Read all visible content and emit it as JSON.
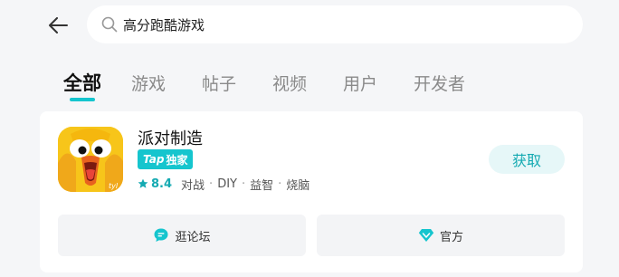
{
  "search": {
    "query": "高分跑酷游戏"
  },
  "tabs": [
    {
      "label": "全部",
      "active": true
    },
    {
      "label": "游戏",
      "active": false
    },
    {
      "label": "帖子",
      "active": false
    },
    {
      "label": "视频",
      "active": false
    },
    {
      "label": "用户",
      "active": false
    },
    {
      "label": "开发者",
      "active": false
    }
  ],
  "result": {
    "app_name": "派对制造",
    "badge_brand": "Tap",
    "badge_text": "独家",
    "rating": "8.4",
    "tags": [
      "对战",
      "DIY",
      "益智",
      "烧脑"
    ],
    "get_label": "获取",
    "forum_label": "逛论坛",
    "official_label": "官方",
    "icon_text": "tyl"
  },
  "colors": {
    "accent": "#15c5ce",
    "background": "#f5f6f8",
    "card": "#ffffff"
  },
  "icons": {
    "back": "arrow-left-icon",
    "search": "search-icon",
    "star": "star-icon",
    "forum": "chat-bubble-icon",
    "official": "diamond-icon"
  }
}
